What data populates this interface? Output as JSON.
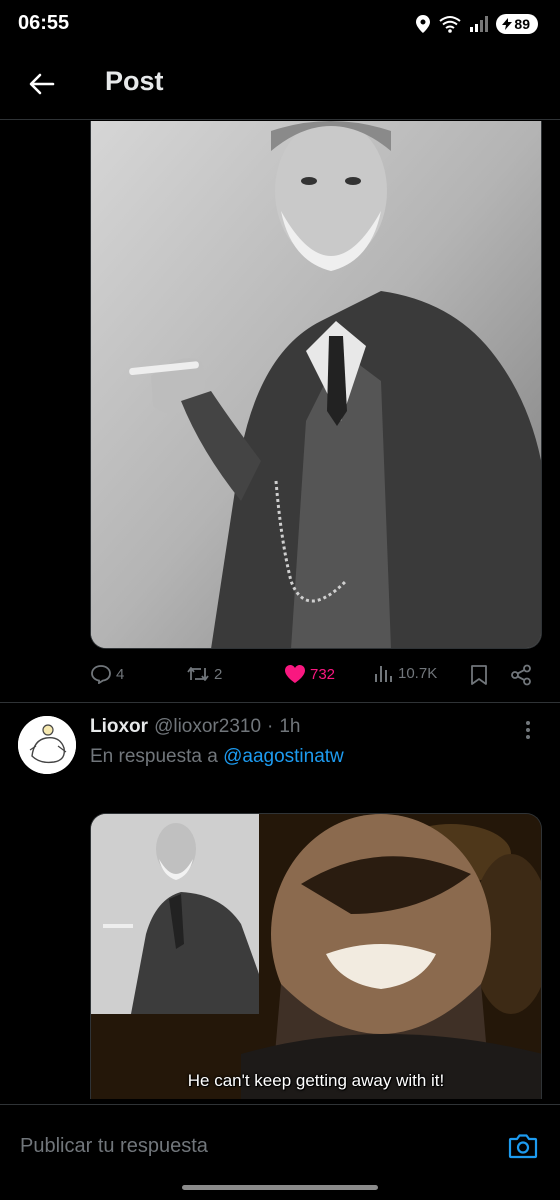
{
  "status_bar": {
    "time": "06:55",
    "battery": "89",
    "icons": [
      "location-icon",
      "wifi-icon",
      "signal-icon",
      "battery-icon"
    ]
  },
  "header": {
    "title": "Post"
  },
  "post": {
    "image_icon": "portrait-photo",
    "actions": {
      "replies": "4",
      "reposts": "2",
      "likes": "732",
      "views": "10.7K"
    },
    "colors": {
      "like": "#f91880",
      "muted": "#71767b"
    }
  },
  "reply": {
    "name": "Lioxor",
    "handle": "@lioxor2310",
    "separator": "·",
    "time": "1h",
    "reply_prefix": "En respuesta a",
    "mention": "@aagostinatw",
    "image_caption": "He can't keep getting away with it!"
  },
  "composer": {
    "placeholder": "Publicar tu respuesta"
  },
  "colors": {
    "background": "#000000",
    "text": "#e7e9ea",
    "link": "#1d9bf0",
    "border": "#2f3336"
  }
}
